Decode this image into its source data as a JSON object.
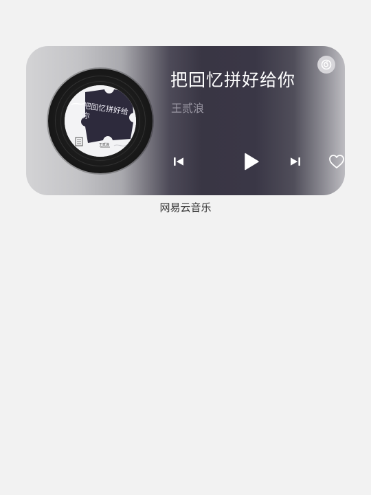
{
  "widget": {
    "title": "把回忆拼好给你",
    "artist": "王贰浪",
    "album_cover_text": "把回忆拼好给你",
    "album_artist_small": "王贰浪",
    "icons": {
      "logo": "netease-cloud-music-logo-icon",
      "prev": "skip-previous-icon",
      "play": "play-icon",
      "next": "skip-next-icon",
      "like": "heart-icon"
    },
    "colors": {
      "title": "#ffffff",
      "artist": "#9b98a4",
      "dark_panel": "#393644",
      "light_panel": "#d3d3d5"
    }
  },
  "caption": "网易云音乐"
}
